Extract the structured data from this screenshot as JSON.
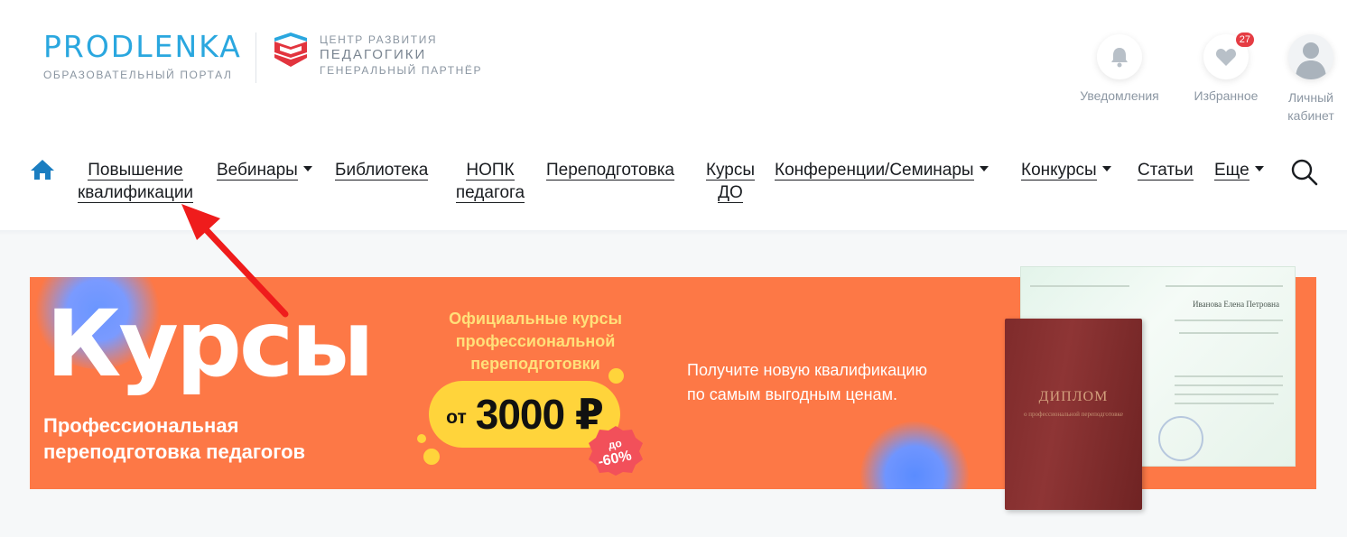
{
  "logo": {
    "name": "PRODLENKA",
    "tagline": "ОБРАЗОВАТЕЛЬНЫЙ ПОРТАЛ"
  },
  "partner": {
    "line1": "ЦЕНТР РАЗВИТИЯ",
    "line2": "ПЕДАГОГИКИ",
    "line3": "ГЕНЕРАЛЬНЫЙ ПАРТНЁР"
  },
  "user_actions": {
    "notifications": {
      "label": "Уведомления",
      "icon": "bell-icon"
    },
    "favorites": {
      "label": "Избранное",
      "icon": "heart-icon",
      "badge": "27"
    },
    "account": {
      "label_line1": "Личный",
      "label_line2": "кабинет",
      "icon": "user-icon"
    }
  },
  "nav": {
    "home_icon": "home-icon",
    "items": [
      {
        "line1": "Повышение",
        "line2": "квалификации",
        "dropdown": false
      },
      {
        "line1": "Вебинары",
        "dropdown": true
      },
      {
        "line1": "Библиотека",
        "dropdown": false
      },
      {
        "line1": "НОПК",
        "line2": "педагога",
        "dropdown": false
      },
      {
        "line1": "Переподготовка",
        "dropdown": false
      },
      {
        "line1": "Курсы",
        "line2": "ДО",
        "dropdown": false
      },
      {
        "line1": "Конференции/Семинары",
        "dropdown": true
      },
      {
        "line1": "Конкурсы",
        "dropdown": true
      },
      {
        "line1": "Статьи",
        "dropdown": false
      },
      {
        "line1": "Еще",
        "dropdown": true
      }
    ],
    "search_icon": "search-icon"
  },
  "banner": {
    "headline": "Курсы",
    "subtitle_line1": "Профессиональная",
    "subtitle_line2": "переподготовка педагогов",
    "official_line1": "Официальные курсы",
    "official_line2": "профессиональной",
    "official_line3": "переподготовки",
    "price_prefix": "от",
    "price_value": "3000 ₽",
    "discount_line1": "до",
    "discount_line2": "-60%",
    "promo_line1": "Получите новую квалификацию",
    "promo_line2": "по самым выгодным ценам.",
    "diploma_title": "ДИПЛОМ",
    "diploma_subtitle": "о профессиональной переподготовке",
    "diploma_name": "Иванова Елена Петровна",
    "colors": {
      "banner_bg": "#fd7846",
      "price_pill": "#ffd43b",
      "official_text": "#ffe07a",
      "discount_badge": "#f2505a"
    }
  },
  "colors": {
    "brand_blue": "#2aa7df",
    "partner_red": "#e2343e",
    "arrow_red": "#ef1c1c",
    "badge_red": "#e53c43"
  }
}
